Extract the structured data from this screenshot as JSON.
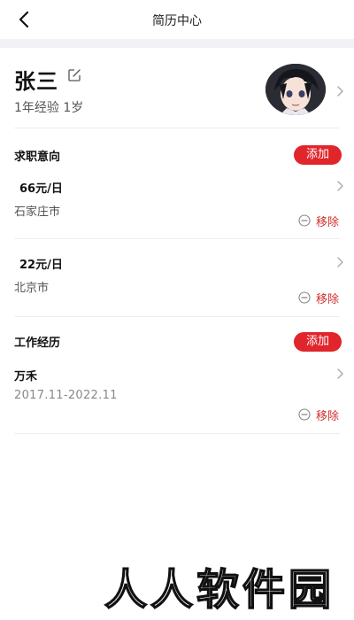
{
  "header": {
    "title": "简历中心"
  },
  "profile": {
    "name": "张三",
    "meta": "1年经验 1岁"
  },
  "job_intent": {
    "section_title": "求职意向",
    "add_label": "添加",
    "items": [
      {
        "salary": "66元/日",
        "city": "石家庄市",
        "remove_label": "移除"
      },
      {
        "salary": "22元/日",
        "city": "北京市",
        "remove_label": "移除"
      }
    ]
  },
  "work_experience": {
    "section_title": "工作经历",
    "add_label": "添加",
    "items": [
      {
        "company": "万禾",
        "period": "2017.11-2022.11",
        "remove_label": "移除"
      }
    ]
  },
  "watermark": "人人软件园",
  "colors": {
    "accent": "#e0252b",
    "remove_text": "#d3302e",
    "band": "#f2f2f6"
  },
  "icons": {
    "back": "chevron-left-icon",
    "edit": "edit-icon",
    "chevron": "chevron-right-icon",
    "remove": "minus-circle-icon"
  }
}
